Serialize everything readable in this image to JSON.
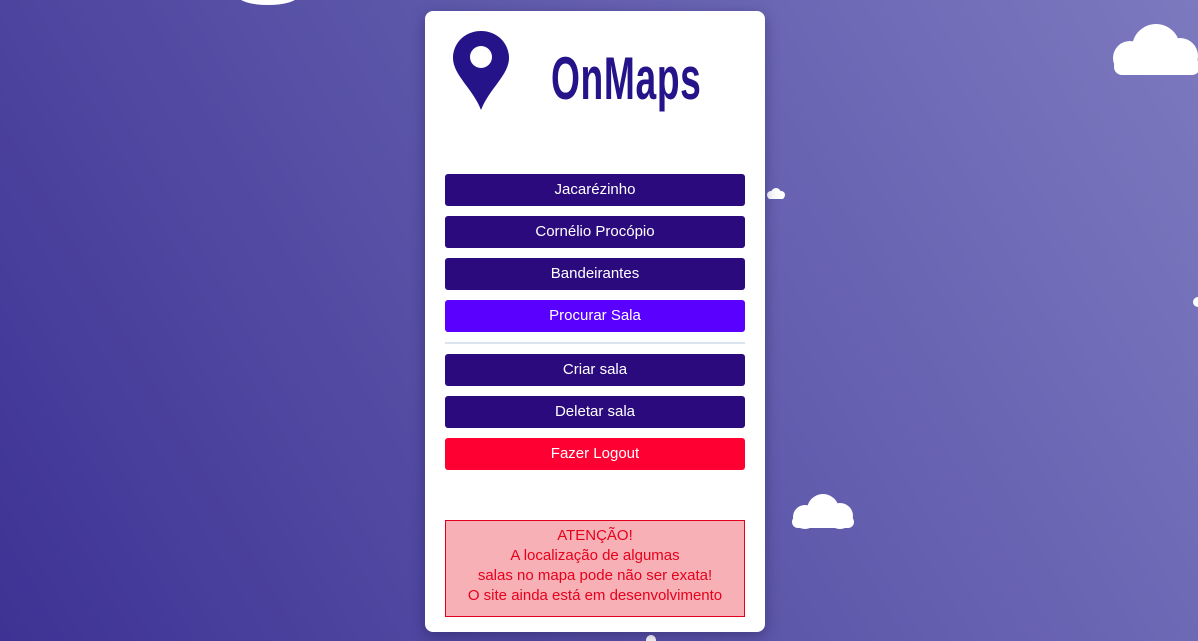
{
  "app": {
    "brand_name": "OnMaps"
  },
  "menu": {
    "items": [
      {
        "label": "Jacarézinho"
      },
      {
        "label": "Cornélio Procópio"
      },
      {
        "label": "Bandeirantes"
      },
      {
        "label": "Procurar Sala"
      },
      {
        "label": "Criar sala"
      },
      {
        "label": "Deletar sala"
      },
      {
        "label": "Fazer Logout"
      }
    ]
  },
  "warning": {
    "lines": [
      "ATENÇÃO!",
      "A localização de algumas",
      "salas no mapa pode não ser exata!",
      "O site ainda está em desenvolvimento"
    ]
  },
  "colors": {
    "brand": "#25138a",
    "button_dark": "#2b0a7e",
    "button_highlight": "#5a00ff",
    "button_danger": "#ff0033",
    "warning_text": "#e6001c",
    "warning_bg": "#f6b0b6"
  },
  "icons": {
    "logo": "map-pin-icon",
    "background": "cloud-icon"
  }
}
